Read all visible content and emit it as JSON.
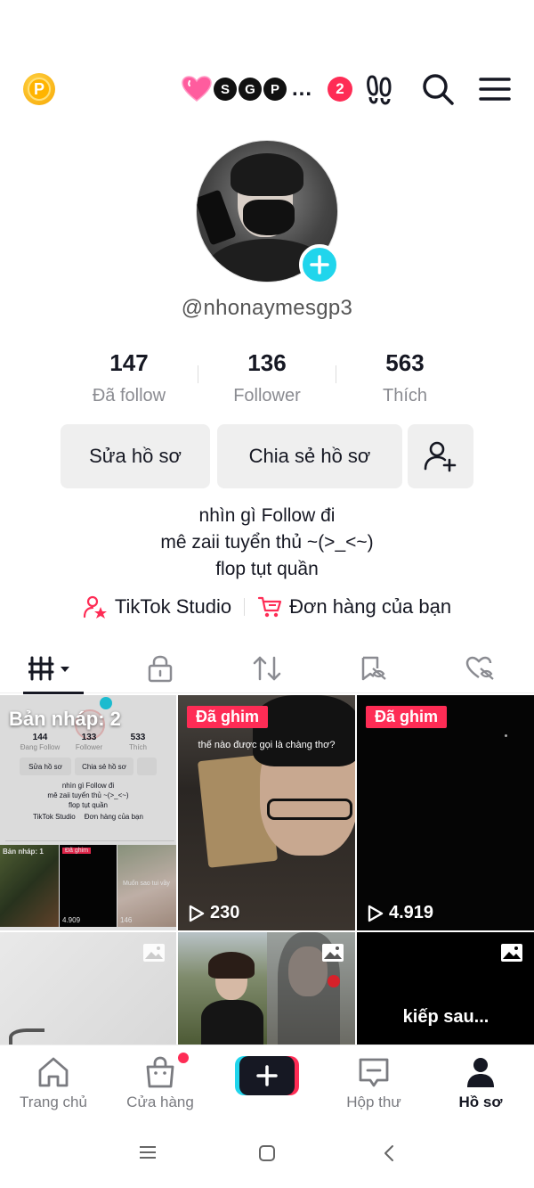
{
  "topbar": {
    "coin_letter": "P",
    "friend_letters": [
      "S",
      "G",
      "P"
    ],
    "more": "...",
    "notification_count": "2"
  },
  "profile": {
    "username": "@nhonaymesgp3",
    "stats": [
      {
        "value": "147",
        "label": "Đã follow"
      },
      {
        "value": "136",
        "label": "Follower"
      },
      {
        "value": "563",
        "label": "Thích"
      }
    ],
    "edit_button": "Sửa hồ sơ",
    "share_button": "Chia sẻ hồ sơ",
    "bio": [
      "nhìn gì Follow đi",
      "mê zaii tuyển thủ ~(>_<~)",
      "flop tụt quần"
    ],
    "links": {
      "studio": "TikTok Studio",
      "orders": "Đơn hàng của bạn"
    }
  },
  "grid": {
    "draft": {
      "label": "Bản nháp: 2",
      "mini": {
        "stats": [
          {
            "value": "144",
            "label": "Đang Follow"
          },
          {
            "value": "133",
            "label": "Follower"
          },
          {
            "value": "533",
            "label": "Thích"
          }
        ],
        "edit": "Sửa hồ sơ",
        "share": "Chia sẻ hồ sơ",
        "bio": [
          "nhìn gì Follow đi",
          "mê zaii tuyển thủ ~(>_<~)",
          "flop tụt quần"
        ],
        "studio": "TikTok Studio",
        "orders": "Đơn hàng của bạn",
        "draft": "Bản nháp: 1",
        "pin": "Đã ghim",
        "views1": "4.909",
        "views2": "146",
        "caption": "Muốn sao tui vầy"
      }
    },
    "pinned_label": "Đã ghim",
    "video2": {
      "caption": "thế nào được gọi là chàng thơ?",
      "views": "230"
    },
    "video3": {
      "views": "4.919"
    },
    "photo6": {
      "caption": "kiếp sau..."
    }
  },
  "bottomnav": {
    "home": "Trang chủ",
    "shop": "Cửa hàng",
    "inbox": "Hộp thư",
    "profile": "Hồ sơ"
  },
  "colors": {
    "accent": "#fe2c55",
    "cyan": "#20d5ec",
    "text": "#161823",
    "muted": "#8a8b91"
  }
}
